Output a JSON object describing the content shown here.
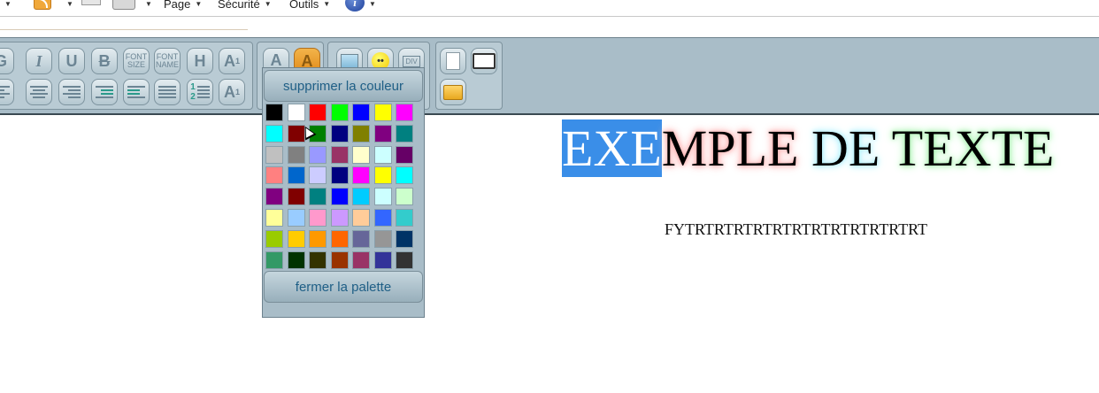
{
  "ie_bar": {
    "page_menu": "Page",
    "security_menu": "Sécurité",
    "tools_menu": "Outils"
  },
  "toolbar": {
    "bold": "G",
    "italic": "I",
    "underline": "U",
    "strike": "B",
    "font_size": [
      "FONT",
      "SIZE"
    ],
    "font_name": [
      "FONT",
      "NAME"
    ],
    "heading": "H",
    "superscript": "A",
    "superscript_sup": "1",
    "subscript": "A",
    "subscript_sub": "1",
    "text_color": "A",
    "highlight_color": "A",
    "div_button": "DIV",
    "text_color_underline": "#e02020",
    "highlight_bg": "#f0a030"
  },
  "palette": {
    "remove_color": "supprimer la couleur",
    "close_palette": "fermer la palette",
    "swatches": [
      "#000000",
      "#ffffff",
      "#ff0000",
      "#00ff00",
      "#0000ff",
      "#ffff00",
      "#ff00ff",
      "#00ffff",
      "#800000",
      "#008000",
      "#000080",
      "#808000",
      "#800080",
      "#008080",
      "#c0c0c0",
      "#808080",
      "#9999ff",
      "#993366",
      "#ffffcc",
      "#ccffff",
      "#660066",
      "#ff8080",
      "#0066cc",
      "#ccccff",
      "#000080",
      "#ff00ff",
      "#ffff00",
      "#00ffff",
      "#800080",
      "#800000",
      "#008080",
      "#0000ff",
      "#00ccff",
      "#ccffff",
      "#ccffcc",
      "#ffff99",
      "#99ccff",
      "#ff99cc",
      "#cc99ff",
      "#ffcc99",
      "#3366ff",
      "#33cccc",
      "#99cc00",
      "#ffcc00",
      "#ff9900",
      "#ff6600",
      "#666699",
      "#969696",
      "#003366",
      "#339966",
      "#003300",
      "#333300",
      "#993300",
      "#993366",
      "#333399",
      "#333333"
    ]
  },
  "document": {
    "title_selected": "EXE",
    "title_pink": "MPLE",
    "title_cyan": "DE",
    "title_green": "TEXTE",
    "body": "FYTRTRTRTRTRTRTRTRTRTRTRTRT"
  }
}
